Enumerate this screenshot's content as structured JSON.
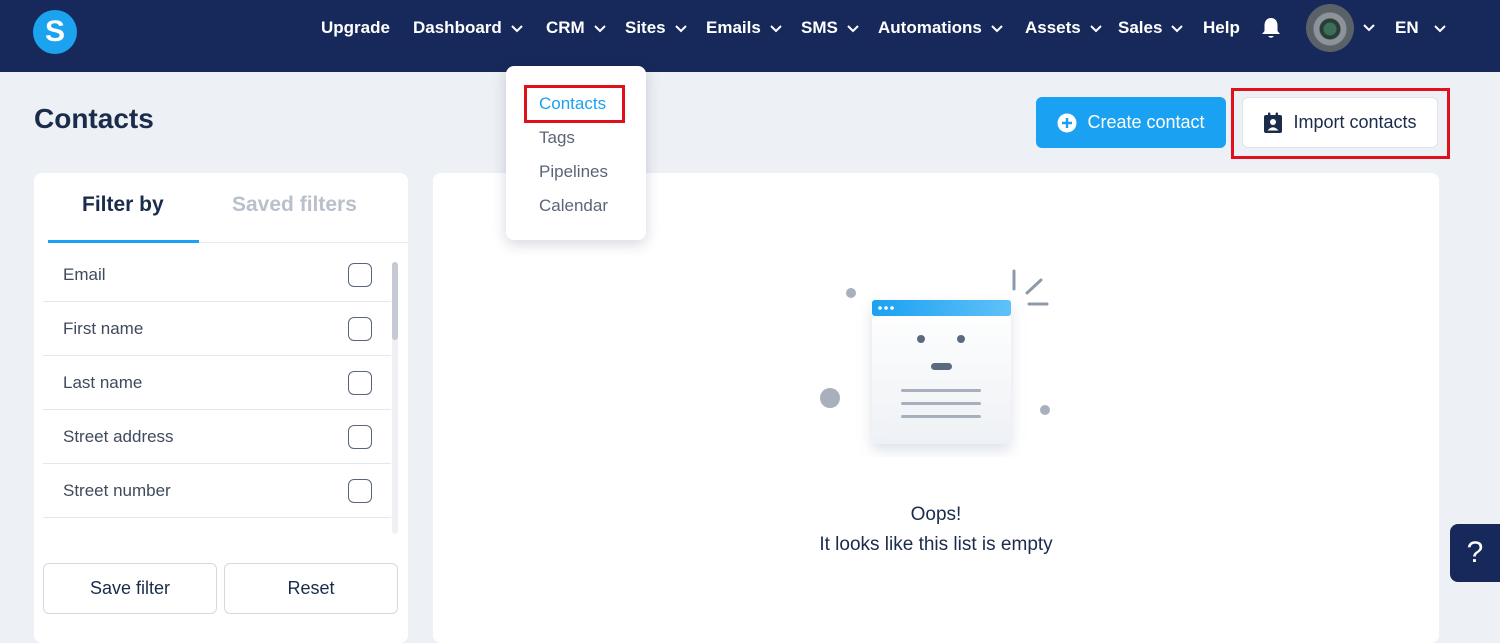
{
  "app": {
    "logo_letter": "S",
    "brand_color": "#1ca3f0",
    "nav_bg": "#16295a",
    "highlight_color": "#e1101d"
  },
  "nav": {
    "items": [
      {
        "label": "Upgrade",
        "has_dropdown": false
      },
      {
        "label": "Dashboard",
        "has_dropdown": true
      },
      {
        "label": "CRM",
        "has_dropdown": true
      },
      {
        "label": "Sites",
        "has_dropdown": true
      },
      {
        "label": "Emails",
        "has_dropdown": true
      },
      {
        "label": "SMS",
        "has_dropdown": true
      },
      {
        "label": "Automations",
        "has_dropdown": true
      },
      {
        "label": "Assets",
        "has_dropdown": true
      },
      {
        "label": "Sales",
        "has_dropdown": true
      },
      {
        "label": "Help",
        "has_dropdown": false
      }
    ],
    "language": "EN"
  },
  "crm_menu": {
    "items": [
      "Contacts",
      "Tags",
      "Pipelines",
      "Calendar"
    ],
    "active": "Contacts"
  },
  "page": {
    "title": "Contacts",
    "create_button": "Create contact",
    "import_button": "Import contacts"
  },
  "filters": {
    "tabs": [
      {
        "label": "Filter by",
        "active": true
      },
      {
        "label": "Saved filters",
        "active": false
      }
    ],
    "fields": [
      {
        "label": "Email",
        "checked": false
      },
      {
        "label": "First name",
        "checked": false
      },
      {
        "label": "Last name",
        "checked": false
      },
      {
        "label": "Street address",
        "checked": false
      },
      {
        "label": "Street number",
        "checked": false
      }
    ],
    "save_button": "Save filter",
    "reset_button": "Reset"
  },
  "empty_state": {
    "title": "Oops!",
    "message": "It looks like this list is empty"
  },
  "help_button": "?"
}
